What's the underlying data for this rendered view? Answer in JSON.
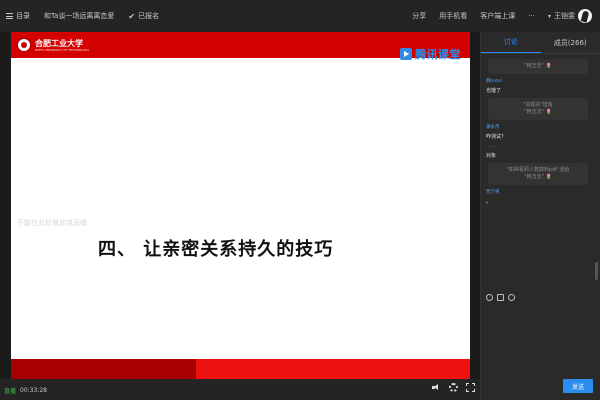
{
  "topbar": {
    "menu_label": "目录",
    "course_title": "和Ta谈一场远离离恋爱",
    "enrolled_label": "已报名",
    "share_label": "分享",
    "mobile_label": "用手机看",
    "client_label": "客户端上课",
    "more_label": "···",
    "user_name": "王铠雯"
  },
  "slide": {
    "logo_cn": "合肥工业大学",
    "logo_en": "HEFEI UNIVERSITY OF TECHNOLOGY",
    "brand_name": "腾讯课堂",
    "watermark": "不能在此处播放或直播",
    "title": "四、 让亲密关系持久的技巧"
  },
  "player": {
    "live_badge": "直播",
    "elapsed": "00:33:28"
  },
  "panel": {
    "tabs": [
      {
        "label": "讨论"
      },
      {
        "label": "成员(266)"
      }
    ],
    "chat": {
      "sys1": {
        "line1": "\"韩玉洁\"",
        "flower": "🌷"
      },
      "msg1": {
        "nick": "魏hotel",
        "text": "也饿了"
      },
      "sys2": {
        "line1": "\"高超宗\"送给",
        "line2": "\"韩玉洁\"",
        "flower": "🌷"
      },
      "msg2": {
        "nick": "蒲永杰",
        "text": "咋测试?"
      },
      "msg3": {
        "nick": "……",
        "text": "对象"
      },
      "sys3": {
        "line1": "\"如得看网人数搞到pdt\"送给",
        "line2": "\"韩玉洁\"",
        "flower": "🌷"
      },
      "msg4": {
        "nick": "贾万夷",
        "text": "。"
      }
    },
    "send_label": "发送"
  }
}
